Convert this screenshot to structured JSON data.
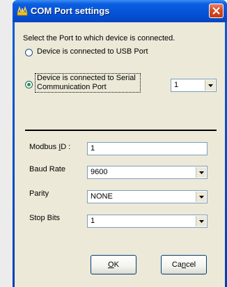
{
  "window": {
    "title": "COM Port settings"
  },
  "port_section": {
    "heading": "Select the Port to which device is connected.",
    "usb_option": {
      "label": "Device is connected to USB Port",
      "selected": false
    },
    "serial_option": {
      "label_line1": "Device is connected to Serial",
      "label_line2": "Communication Port",
      "selected": true
    },
    "port_number": {
      "value": "1"
    }
  },
  "settings": {
    "modbus_id": {
      "label_pre": "Modbus ",
      "label_accel": "I",
      "label_post": "D :",
      "value": "1"
    },
    "baud_rate": {
      "label": "Baud Rate",
      "value": "9600"
    },
    "parity": {
      "label": "Parity",
      "value": "NONE"
    },
    "stop_bits": {
      "label": "Stop Bits",
      "value": "1"
    }
  },
  "buttons": {
    "ok": {
      "accel": "O",
      "rest": "K"
    },
    "cancel": {
      "pre": "Ca",
      "accel": "n",
      "post": "cel"
    }
  },
  "colors": {
    "titlebar": "#0654d8",
    "client_bg": "#ece9d8",
    "radio_dot": "#21a121",
    "close_button": "#d84a22"
  },
  "icons": {
    "app": "app-icon",
    "close": "close-icon",
    "dropdown": "chevron-down-icon"
  }
}
